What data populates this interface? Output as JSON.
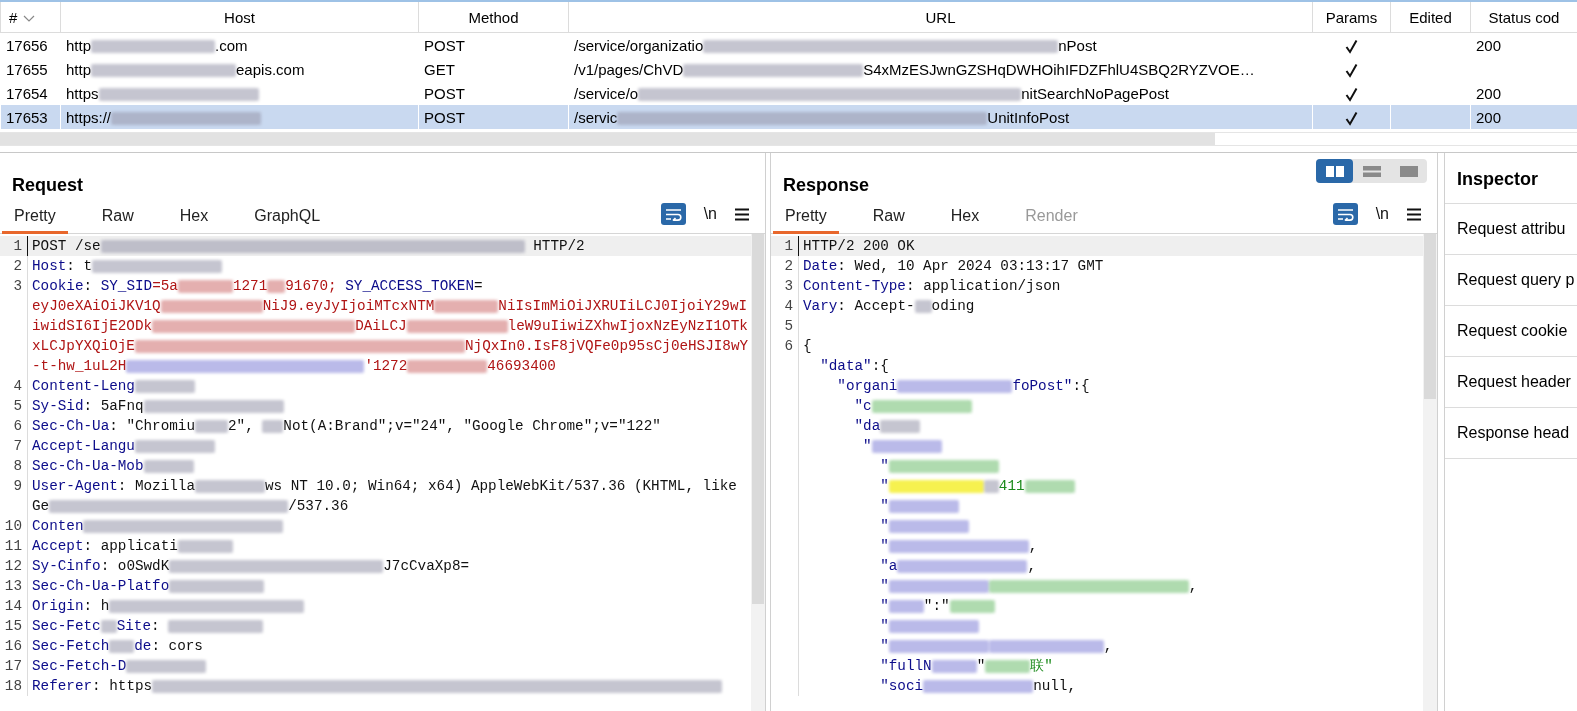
{
  "history": {
    "columns": [
      {
        "label": "#",
        "sorted": true
      },
      {
        "label": "Host",
        "sorted": false
      },
      {
        "label": "Method",
        "sorted": false
      },
      {
        "label": "URL",
        "sorted": false
      },
      {
        "label": "Params",
        "sorted": false
      },
      {
        "label": "Edited",
        "sorted": false
      },
      {
        "label": "Status cod",
        "sorted": false
      }
    ],
    "rows": [
      {
        "number": "17656",
        "host": [
          {
            "kind": "plain",
            "t": "http"
          },
          {
            "kind": "blur"
          },
          {
            "kind": "plain",
            "t": ".com"
          }
        ],
        "method": "POST",
        "url": [
          {
            "kind": "plain",
            "t": "/service/organizatio"
          },
          {
            "kind": "blur"
          },
          {
            "kind": "plain",
            "t": "nPost"
          }
        ],
        "params": true,
        "edited": false,
        "status": "200",
        "selected": false
      },
      {
        "number": "17655",
        "host": [
          {
            "kind": "plain",
            "t": "http"
          },
          {
            "kind": "blur"
          },
          {
            "kind": "plain",
            "t": "eapis.com"
          }
        ],
        "method": "GET",
        "url": [
          {
            "kind": "plain",
            "t": "/v1/pages/ChVD"
          },
          {
            "kind": "blur"
          },
          {
            "kind": "plain",
            "t": "S4xMzESJwnGZSHqDWHOihIFDZFhlU4SBQ2RYZVOE…"
          }
        ],
        "params": true,
        "edited": false,
        "selected": false
      },
      {
        "number": "17654",
        "host": [
          {
            "kind": "plain",
            "t": "https"
          },
          {
            "kind": "blur"
          }
        ],
        "method": "POST",
        "url": [
          {
            "kind": "plain",
            "t": "/service/o"
          },
          {
            "kind": "blur"
          },
          {
            "kind": "plain",
            "t": "nitSearchNoPagePost"
          }
        ],
        "params": true,
        "edited": false,
        "status": "200",
        "selected": false
      },
      {
        "number": "17653",
        "host": [
          {
            "kind": "plain",
            "t": "https://"
          },
          {
            "kind": "blur"
          }
        ],
        "method": "POST",
        "url": [
          {
            "kind": "plain",
            "t": "/servic"
          },
          {
            "kind": "blur"
          },
          {
            "kind": "plain",
            "t": "UnitInfoPost"
          }
        ],
        "params": true,
        "edited": false,
        "status": "200",
        "selected": true
      }
    ]
  },
  "request": {
    "title": "Request",
    "tabs": [
      {
        "label": "Pretty",
        "selected": true,
        "disabled": false
      },
      {
        "label": "Raw",
        "selected": false,
        "disabled": false
      },
      {
        "label": "Hex",
        "selected": false,
        "disabled": false
      },
      {
        "label": "GraphQL",
        "selected": false,
        "disabled": false
      }
    ],
    "wrap_on": true,
    "newline_label": "\\n",
    "lines": [
      {
        "num": "1",
        "current": true,
        "wraps": [
          {
            "parts": [
              {
                "kind": "plain",
                "t": "POST /se"
              },
              {
                "kind": "blur"
              },
              {
                "kind": "plain",
                "t": " HTTP/2"
              }
            ]
          }
        ]
      },
      {
        "num": "2",
        "current": false,
        "wraps": [
          {
            "parts": [
              {
                "kind": "key",
                "t": "Host"
              },
              {
                "kind": "plain",
                "t": ": t"
              },
              {
                "kind": "blur"
              }
            ]
          }
        ]
      },
      {
        "num": "3",
        "current": false,
        "wraps": [
          {
            "parts": [
              {
                "kind": "key",
                "t": "Cookie"
              },
              {
                "kind": "plain",
                "t": ": "
              },
              {
                "kind": "key",
                "t": "SY_SID"
              },
              {
                "kind": "red",
                "t": "=5a"
              },
              {
                "kind": "blur-red"
              },
              {
                "kind": "red",
                "t": "1271"
              },
              {
                "kind": "blur-red"
              },
              {
                "kind": "red",
                "t": "91670; "
              },
              {
                "kind": "key",
                "t": "SY_ACCESS_TOKEN"
              },
              {
                "kind": "plain",
                "t": "="
              }
            ]
          },
          {
            "parts": [
              {
                "kind": "red",
                "t": "eyJ0eXAiOiJKV1Q"
              },
              {
                "kind": "blur-red"
              },
              {
                "kind": "red",
                "t": "NiJ9.eyJyIjoiMTcxNTM"
              },
              {
                "kind": "blur-red"
              },
              {
                "kind": "red",
                "t": "NiIsImMiOiJXRUIiLCJ0IjoiY29wI"
              }
            ]
          },
          {
            "parts": [
              {
                "kind": "red",
                "t": "iwidSI6IjE2ODk"
              },
              {
                "kind": "blur-red"
              },
              {
                "kind": "red",
                "t": "DAiLCJ"
              },
              {
                "kind": "blur-red"
              },
              {
                "kind": "red",
                "t": "leW9uIiwiZXhwIjoxNzEyNzI1OTk"
              }
            ]
          },
          {
            "parts": [
              {
                "kind": "red",
                "t": "xLCJpYXQiOjE"
              },
              {
                "kind": "blur-red"
              },
              {
                "kind": "red",
                "t": "NjQxIn0.IsF8jVQFe0p95sCj0eHSJI8wY"
              }
            ]
          },
          {
            "parts": [
              {
                "kind": "red",
                "t": "-t-hw_1uL2H"
              },
              {
                "kind": "blur-blue"
              },
              {
                "kind": "red",
                "t": "'1272"
              },
              {
                "kind": "blur-red"
              },
              {
                "kind": "red",
                "t": "46693400"
              }
            ]
          }
        ]
      },
      {
        "num": "4",
        "current": false,
        "wraps": [
          {
            "parts": [
              {
                "kind": "key",
                "t": "Content-Leng"
              },
              {
                "kind": "blur"
              }
            ]
          }
        ]
      },
      {
        "num": "5",
        "current": false,
        "wraps": [
          {
            "parts": [
              {
                "kind": "key",
                "t": "Sy-Sid"
              },
              {
                "kind": "plain",
                "t": ": 5aFnq"
              },
              {
                "kind": "blur"
              }
            ]
          }
        ]
      },
      {
        "num": "6",
        "current": false,
        "wraps": [
          {
            "parts": [
              {
                "kind": "key",
                "t": "Sec-Ch-Ua"
              },
              {
                "kind": "plain",
                "t": ": \"Chromiu"
              },
              {
                "kind": "blur"
              },
              {
                "kind": "plain",
                "t": "2\", "
              },
              {
                "kind": "blur"
              },
              {
                "kind": "plain",
                "t": "Not(A:Brand\";v=\"24\", \"Google Chrome\";v=\"122\""
              }
            ]
          }
        ]
      },
      {
        "num": "7",
        "current": false,
        "wraps": [
          {
            "parts": [
              {
                "kind": "key",
                "t": "Accept-Langu"
              },
              {
                "kind": "blur"
              }
            ]
          }
        ]
      },
      {
        "num": "8",
        "current": false,
        "wraps": [
          {
            "parts": [
              {
                "kind": "key",
                "t": "Sec-Ch-Ua-Mob"
              },
              {
                "kind": "blur"
              }
            ]
          }
        ]
      },
      {
        "num": "9",
        "current": false,
        "wraps": [
          {
            "parts": [
              {
                "kind": "key",
                "t": "User-Agent"
              },
              {
                "kind": "plain",
                "t": ": Mozilla"
              },
              {
                "kind": "blur"
              },
              {
                "kind": "plain",
                "t": "ws NT 10.0; Win64; x64) AppleWebKit/537.36 (KHTML, like"
              }
            ]
          },
          {
            "parts": [
              {
                "kind": "plain",
                "t": "Ge"
              },
              {
                "kind": "blur"
              },
              {
                "kind": "plain",
                "t": "/537.36"
              }
            ]
          }
        ]
      },
      {
        "num": "10",
        "current": false,
        "wraps": [
          {
            "parts": [
              {
                "kind": "key",
                "t": "Conten"
              },
              {
                "kind": "blur"
              }
            ]
          }
        ]
      },
      {
        "num": "11",
        "current": false,
        "wraps": [
          {
            "parts": [
              {
                "kind": "key",
                "t": "Accept"
              },
              {
                "kind": "plain",
                "t": ": applicati"
              },
              {
                "kind": "blur"
              }
            ]
          }
        ]
      },
      {
        "num": "12",
        "current": false,
        "wraps": [
          {
            "parts": [
              {
                "kind": "key",
                "t": "Sy-Cinfo"
              },
              {
                "kind": "plain",
                "t": ": o0SwdK"
              },
              {
                "kind": "blur"
              },
              {
                "kind": "plain",
                "t": "J7cCvaXp8="
              }
            ]
          }
        ]
      },
      {
        "num": "13",
        "current": false,
        "wraps": [
          {
            "parts": [
              {
                "kind": "key",
                "t": "Sec-Ch-Ua-Platfo"
              },
              {
                "kind": "blur"
              }
            ]
          }
        ]
      },
      {
        "num": "14",
        "current": false,
        "wraps": [
          {
            "parts": [
              {
                "kind": "key",
                "t": "Origin"
              },
              {
                "kind": "plain",
                "t": ": h"
              },
              {
                "kind": "blur"
              }
            ]
          }
        ]
      },
      {
        "num": "15",
        "current": false,
        "wraps": [
          {
            "parts": [
              {
                "kind": "key",
                "t": "Sec-Fetc"
              },
              {
                "kind": "blur"
              },
              {
                "kind": "key",
                "t": "Site"
              },
              {
                "kind": "plain",
                "t": ": "
              },
              {
                "kind": "blur"
              }
            ]
          }
        ]
      },
      {
        "num": "16",
        "current": false,
        "wraps": [
          {
            "parts": [
              {
                "kind": "key",
                "t": "Sec-Fetch"
              },
              {
                "kind": "blur"
              },
              {
                "kind": "key",
                "t": "de"
              },
              {
                "kind": "plain",
                "t": ": cors"
              }
            ]
          }
        ]
      },
      {
        "num": "17",
        "current": false,
        "wraps": [
          {
            "parts": [
              {
                "kind": "key",
                "t": "Sec-Fetch-D"
              },
              {
                "kind": "blur"
              }
            ]
          }
        ]
      },
      {
        "num": "18",
        "current": false,
        "wraps": [
          {
            "parts": [
              {
                "kind": "key",
                "t": "Referer"
              },
              {
                "kind": "plain",
                "t": ": https"
              },
              {
                "kind": "blur"
              }
            ]
          }
        ]
      }
    ]
  },
  "layout_modes": [
    {
      "kind": "columns",
      "selected": true
    },
    {
      "kind": "rows",
      "selected": false
    },
    {
      "kind": "single",
      "selected": false
    }
  ],
  "response": {
    "title": "Response",
    "tabs": [
      {
        "label": "Pretty",
        "selected": true,
        "disabled": false
      },
      {
        "label": "Raw",
        "selected": false,
        "disabled": false
      },
      {
        "label": "Hex",
        "selected": false,
        "disabled": false
      },
      {
        "label": "Render",
        "selected": false,
        "disabled": true
      }
    ],
    "wrap_on": true,
    "newline_label": "\\n",
    "lines": [
      {
        "num": "1",
        "current": true,
        "wraps": [
          {
            "parts": [
              {
                "kind": "plain",
                "t": "HTTP/2 200 OK"
              }
            ]
          }
        ]
      },
      {
        "num": "2",
        "current": false,
        "wraps": [
          {
            "parts": [
              {
                "kind": "key",
                "t": "Date"
              },
              {
                "kind": "plain",
                "t": ": Wed, 10 Apr 2024 03:13:17 GMT"
              }
            ]
          }
        ]
      },
      {
        "num": "3",
        "current": false,
        "wraps": [
          {
            "parts": [
              {
                "kind": "key",
                "t": "Content-Type"
              },
              {
                "kind": "plain",
                "t": ": application/json"
              }
            ]
          }
        ]
      },
      {
        "num": "4",
        "current": false,
        "wraps": [
          {
            "parts": [
              {
                "kind": "key",
                "t": "Vary"
              },
              {
                "kind": "plain",
                "t": ": Accept-"
              },
              {
                "kind": "blur"
              },
              {
                "kind": "plain",
                "t": "oding"
              }
            ]
          }
        ]
      },
      {
        "num": "5",
        "current": false
      },
      {
        "num": "6",
        "current": false,
        "wraps": [
          {
            "parts": [
              {
                "kind": "plain",
                "t": "{"
              }
            ]
          },
          {
            "parts": [
              {
                "kind": "key",
                "t": "  \"data\""
              },
              {
                "kind": "plain",
                "t": ":{"
              }
            ]
          },
          {
            "parts": [
              {
                "kind": "key",
                "t": "    \"organi"
              },
              {
                "kind": "blur-blue"
              },
              {
                "kind": "key",
                "t": "foPost\""
              },
              {
                "kind": "plain",
                "t": ":{"
              }
            ]
          },
          {
            "parts": [
              {
                "kind": "key",
                "t": "      \"c"
              },
              {
                "kind": "blur-green"
              }
            ]
          },
          {
            "parts": [
              {
                "kind": "key",
                "t": "      \"da"
              },
              {
                "kind": "blur"
              }
            ]
          },
          {
            "parts": [
              {
                "kind": "key",
                "t": "       \""
              },
              {
                "kind": "blur-blue"
              }
            ]
          },
          {
            "parts": [
              {
                "kind": "key",
                "t": "         \""
              },
              {
                "kind": "blur-green"
              }
            ]
          },
          {
            "parts": [
              {
                "kind": "key",
                "t": "         \""
              },
              {
                "kind": "blur-hl"
              },
              {
                "kind": "blur"
              },
              {
                "kind": "str",
                "t": "411"
              },
              {
                "kind": "blur-green"
              }
            ]
          },
          {
            "parts": [
              {
                "kind": "key",
                "t": "         \""
              },
              {
                "kind": "blur-blue"
              }
            ]
          },
          {
            "parts": [
              {
                "kind": "key",
                "t": "         \""
              },
              {
                "kind": "blur-blue"
              }
            ]
          },
          {
            "parts": [
              {
                "kind": "key",
                "t": "         \""
              },
              {
                "kind": "blur-blue"
              },
              {
                "kind": "plain",
                "t": ","
              }
            ]
          },
          {
            "parts": [
              {
                "kind": "key",
                "t": "         \"a"
              },
              {
                "kind": "blur-blue"
              },
              {
                "kind": "plain",
                "t": ","
              }
            ]
          },
          {
            "parts": [
              {
                "kind": "key",
                "t": "         \""
              },
              {
                "kind": "blur-blue"
              },
              {
                "kind": "blur-green"
              },
              {
                "kind": "plain",
                "t": ","
              }
            ]
          },
          {
            "parts": [
              {
                "kind": "key",
                "t": "         \""
              },
              {
                "kind": "blur-blue"
              },
              {
                "kind": "plain",
                "t": "\":\""
              },
              {
                "kind": "blur-green"
              }
            ]
          },
          {
            "parts": [
              {
                "kind": "key",
                "t": "         \""
              },
              {
                "kind": "blur-blue"
              }
            ]
          },
          {
            "parts": [
              {
                "kind": "key",
                "t": "         \""
              },
              {
                "kind": "blur-blue"
              },
              {
                "kind": "blur-blue"
              },
              {
                "kind": "plain",
                "t": ","
              }
            ]
          },
          {
            "parts": [
              {
                "kind": "key",
                "t": "         \"fullN"
              },
              {
                "kind": "blur-blue"
              },
              {
                "kind": "plain",
                "t": "\""
              },
              {
                "kind": "blur-green"
              },
              {
                "kind": "str",
                "t": "联\""
              }
            ]
          },
          {
            "parts": [
              {
                "kind": "key",
                "t": "         \"soci"
              },
              {
                "kind": "blur-blue"
              },
              {
                "kind": "plain",
                "t": "null,"
              }
            ]
          }
        ]
      }
    ]
  },
  "inspector": {
    "title": "Inspector",
    "sections": [
      "Request attribu",
      "Request query p",
      "Request cookie",
      "Request header",
      "Response head"
    ]
  }
}
